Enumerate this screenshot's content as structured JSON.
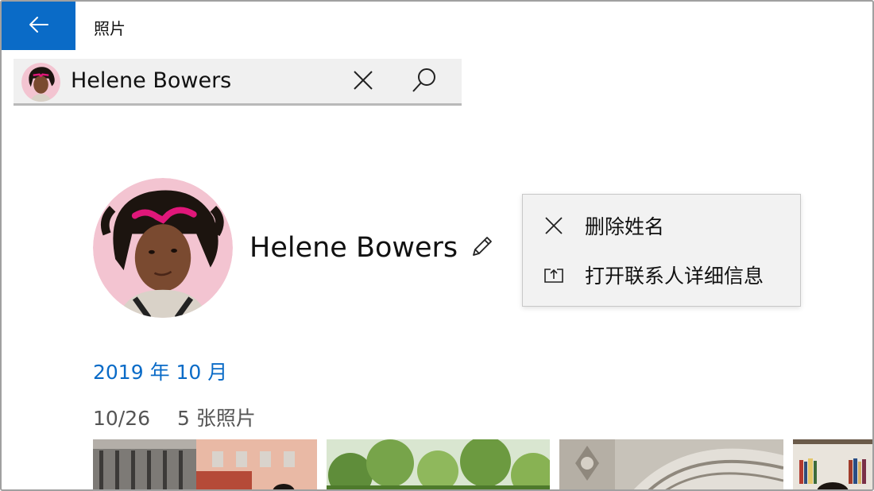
{
  "app": {
    "title": "照片"
  },
  "icons": {
    "back": "back-arrow-icon",
    "clear": "close-icon",
    "search": "search-icon",
    "edit": "pencil-icon",
    "remove_name": "close-icon",
    "open_contact": "open-contact-icon"
  },
  "colors": {
    "accent": "#0a6bc7",
    "avatar_bg": "#f3c4d1",
    "sunglasses": "#e0177a"
  },
  "search": {
    "value": "Helene Bowers"
  },
  "person": {
    "name": "Helene Bowers"
  },
  "context_menu": {
    "items": [
      {
        "label": "删除姓名",
        "icon": "close-icon"
      },
      {
        "label": "打开联系人详细信息",
        "icon": "open-contact-icon"
      }
    ]
  },
  "timeline": {
    "month": "2019 年 10 月",
    "date": "10/26",
    "count": "5 张照片"
  }
}
